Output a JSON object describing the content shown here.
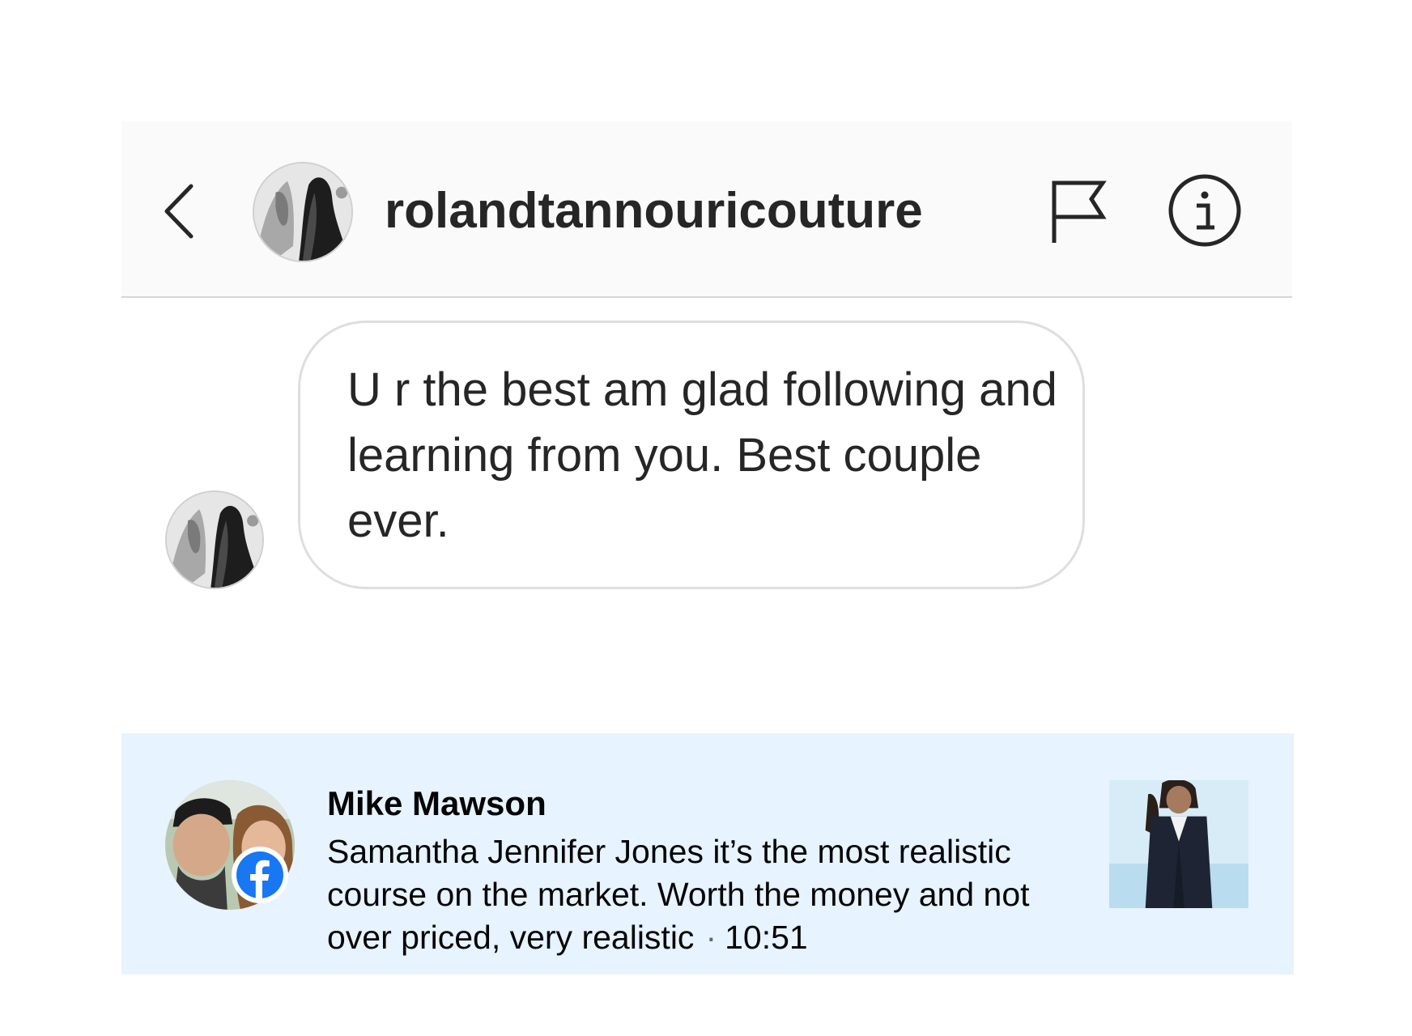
{
  "header": {
    "username": "rolandtannouricouture",
    "back_icon": "chevron-left-icon",
    "flag_icon": "flag-icon",
    "info_icon": "info-icon"
  },
  "message": {
    "text": "U r the best am glad following and learning from you.  Best couple ever."
  },
  "notification": {
    "name": "Mike Mawson",
    "text": "Samantha Jennifer Jones it’s the most realistic course on the market. Worth the money and not over priced, very realistic",
    "separator": "·",
    "time": "10:51",
    "badge_icon": "facebook-icon",
    "accent_color": "#1877f2",
    "background_color": "#e7f3ff"
  }
}
